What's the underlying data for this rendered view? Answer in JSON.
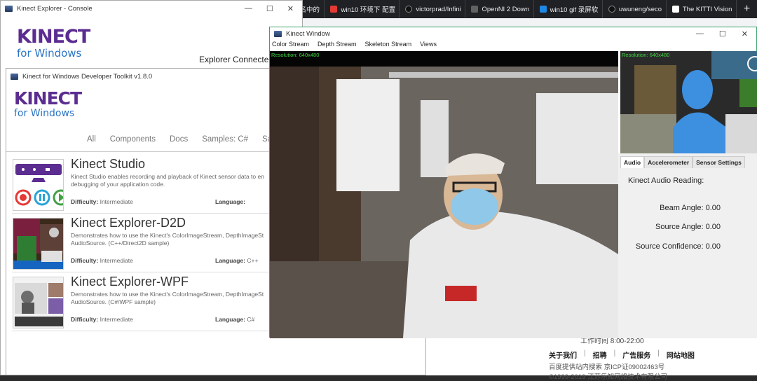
{
  "browser": {
    "tabs": [
      {
        "label": "报名中的",
        "color": "#ff6d00"
      },
      {
        "label": "win10 环境下 配置",
        "color": "#e53935"
      },
      {
        "label": "victorprad/Infini",
        "color": "#9e9e9e"
      },
      {
        "label": "OpenNI 2 Down",
        "color": "#616161"
      },
      {
        "label": "win10 gif 录屏软",
        "color": "#1e88e5"
      },
      {
        "label": "uwuneng/seco",
        "color": "#9e9e9e"
      },
      {
        "label": "The KITTI Vision",
        "color": "#ffffff"
      }
    ],
    "new_tab_label": "+",
    "page": {
      "hours": "工作时间 8:00-22:00",
      "links": [
        "关于我们",
        "招聘",
        "广告服务",
        "网站地图"
      ],
      "icp": "百度提供站内搜索 京ICP证09002463号",
      "copyright": "©1999-2019 江苏乐知网络技术有限公司"
    }
  },
  "console": {
    "title": "Kinect Explorer - Console",
    "logo_word": "KINECT",
    "logo_sub": "for Windows",
    "status": "Explorer Connected D"
  },
  "toolkit": {
    "title": "Kinect for Windows Developer Toolkit v1.8.0",
    "logo_word": "KINECT",
    "logo_sub": "for Windows",
    "nav": [
      "All",
      "Components",
      "Docs",
      "Samples: C#",
      "Samp"
    ],
    "samples": [
      {
        "title": "Kinect Studio",
        "desc": "Kinect Studio enables recording and playback of Kinect sensor data to en debugging of your application code.",
        "difficulty_label": "Difficulty:",
        "difficulty": "Intermediate",
        "language_label": "Language:",
        "language": ""
      },
      {
        "title": "Kinect Explorer-D2D",
        "desc": "Demonstrates how to use the Kinect's ColorImageStream, DepthImageSt AudioSource. (C++/Direct2D sample)",
        "difficulty_label": "Difficulty:",
        "difficulty": "Intermediate",
        "language_label": "Language:",
        "language": "C++"
      },
      {
        "title": "Kinect Explorer-WPF",
        "desc": "Demonstrates how to use the Kinect's ColorImageStream, DepthImageSt AudioSource. (C#/WPF sample)",
        "difficulty_label": "Difficulty:",
        "difficulty": "Intermediate",
        "language_label": "Language:",
        "language": "C#"
      }
    ]
  },
  "kinect_window": {
    "title": "Kinect Window",
    "menu": [
      "Color Stream",
      "Depth Stream",
      "Skeleton Stream",
      "Views"
    ],
    "color_resolution": "Resolution: 640x480",
    "depth_resolution": "Resolution: 640x480",
    "audio_tabs": [
      "Audio",
      "Accelerometer",
      "Sensor Settings"
    ],
    "audio_heading": "Kinect Audio Reading:",
    "readings": [
      {
        "label": "Beam Angle:",
        "value": "0.00"
      },
      {
        "label": "Source Angle:",
        "value": "0.00"
      },
      {
        "label": "Source Confidence:",
        "value": "0.00"
      }
    ]
  },
  "window_controls": {
    "minimize": "—",
    "maximize": "☐",
    "close": "✕"
  }
}
